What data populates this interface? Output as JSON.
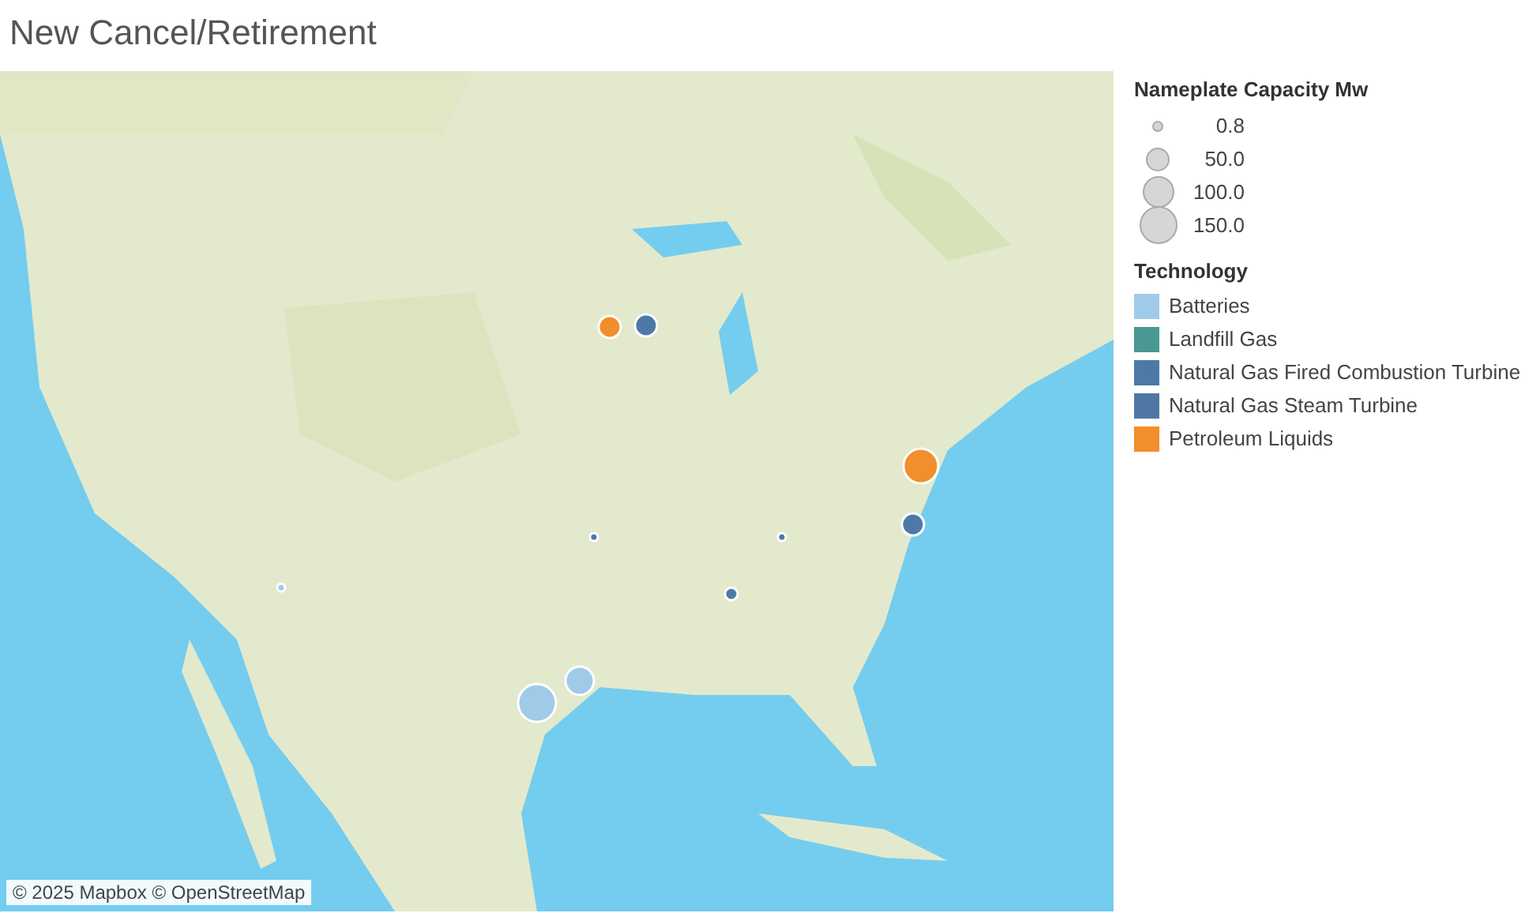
{
  "title": "New Cancel/Retirement",
  "map": {
    "kind": "picture",
    "attribution": "© 2025 Mapbox © OpenStreetMap",
    "points": [
      {
        "color": "#f28e2b"
      },
      {
        "color": "#4e79a7"
      },
      {
        "color": "#f28e2b"
      },
      {
        "color": "#4e79a7"
      },
      {
        "color": "#4e79a7"
      },
      {
        "color": "#4e79a7"
      },
      {
        "color": "#4e79a7"
      },
      {
        "color": "#a0cbe8"
      },
      {
        "color": "#a0cbe8"
      },
      {
        "color": "#a0cbe8"
      }
    ]
  },
  "size_legend": {
    "title": "Nameplate Capacity Mw",
    "items": [
      "0.8",
      "50.0",
      "100.0",
      "150.0"
    ]
  },
  "color_legend": {
    "title": "Technology",
    "items": [
      {
        "label": "Batteries",
        "color": "#a0cbe8"
      },
      {
        "label": "Landfill Gas",
        "color": "#499894"
      },
      {
        "label": "Natural Gas Fired Combustion Turbine",
        "color": "#4e79a7"
      },
      {
        "label": "Natural Gas Steam Turbine",
        "color": "#4f77a5"
      },
      {
        "label": "Petroleum Liquids",
        "color": "#f28e2b"
      }
    ]
  }
}
